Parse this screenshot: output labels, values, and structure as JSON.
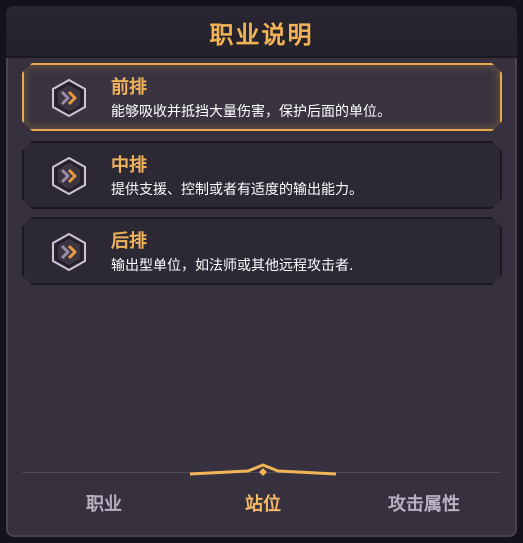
{
  "header": {
    "title": "职业说明"
  },
  "items": [
    {
      "title": "前排",
      "desc": "能够吸收并抵挡大量伤害，保护后面的单位。",
      "selected": true
    },
    {
      "title": "中排",
      "desc": "提供支援、控制或者有适度的输出能力。",
      "selected": false
    },
    {
      "title": "后排",
      "desc": "输出型单位，如法师或其他远程攻击者.",
      "selected": false
    }
  ],
  "tabs": [
    {
      "label": "职业",
      "active": false
    },
    {
      "label": "站位",
      "active": true
    },
    {
      "label": "攻击属性",
      "active": false
    }
  ],
  "colors": {
    "accent": "#f0b35b",
    "panel": "#36303f",
    "item_bg": "#2c2834",
    "chevron": "#e89a3c"
  },
  "icons": [
    "double-chevron-right-icon",
    "hexagon-badge-icon"
  ]
}
